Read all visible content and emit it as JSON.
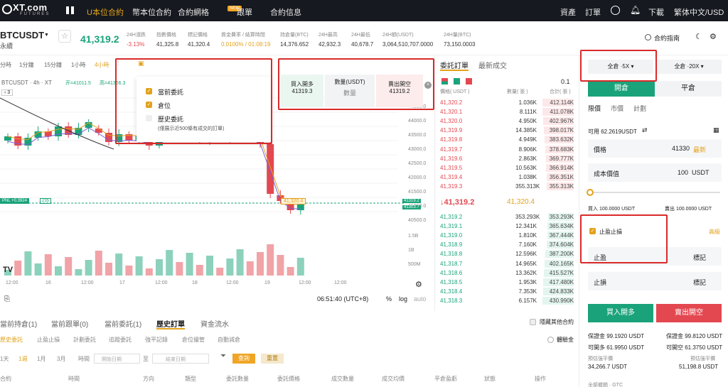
{
  "nav": {
    "logo": "XT.com",
    "logo_sub": "FUTURES",
    "items": [
      "U本位合約",
      "幣本位合約",
      "合約網格",
      "跟單",
      "合約信息"
    ],
    "new_badge": "NEW",
    "right": [
      "資產",
      "訂單",
      "下載",
      "繁体中文/USD"
    ]
  },
  "ticker": {
    "symbol": "BTCUSDT",
    "sub": "永續",
    "price": "41,319.2",
    "stats": [
      {
        "l": "24H漲跌",
        "v": "-3.13%"
      },
      {
        "l": "指數價格",
        "v": "41,325.8"
      },
      {
        "l": "標記價格",
        "v": "41,320.4"
      },
      {
        "l": "資金費率 / 結算時間",
        "v": "0.0100% / 01:08:19"
      },
      {
        "l": "持倉量(BTC)",
        "v": "14,376.652"
      },
      {
        "l": "24H最高",
        "v": "42,932.3"
      },
      {
        "l": "24H最低",
        "v": "40,678.7"
      },
      {
        "l": "24H額(USDT)",
        "v": "3,064,510,707.0000"
      },
      {
        "l": "24H量(BTC)",
        "v": "73,150.0003"
      }
    ],
    "guide": "合約指南"
  },
  "chart": {
    "timeframes": [
      "分時",
      "1分鐘",
      "15分鐘",
      "1小時",
      "4小時"
    ],
    "symbol_line": "BTCUSDT · 4h · XT",
    "open": "开=41011.5",
    "high": "高=41366.3",
    "price_ticks": [
      "44500.0",
      "44000.0",
      "43500.0",
      "43000.0",
      "42500.0",
      "42000.0",
      "41500.0",
      "41000.0",
      "40500.0"
    ],
    "vol_ticks": [
      "1.5B",
      "1B",
      "500M"
    ],
    "dates": [
      "12:00",
      "16",
      "12:00",
      "17",
      "12:00",
      "18",
      "12:00",
      "19",
      "12:00",
      "12:00"
    ],
    "pnl": "PNL +0.3924",
    "pnl_qty": "235",
    "mark": "41,320.4",
    "right_tags": [
      "41319.2",
      "41303.7"
    ],
    "time": "06:51:40 (UTC+8)",
    "bottom_controls": [
      "%",
      "log",
      "auto"
    ],
    "zoom": "3"
  },
  "popup": {
    "items": [
      "當前委託",
      "倉位",
      "歷史委託"
    ],
    "note": "(僅展示近500條有成交的訂單)"
  },
  "quick": {
    "buy_label": "買入開多",
    "buy_price": "41319.3",
    "qty_label": "數量(USDT)",
    "qty_val": "數量",
    "sell_label": "賣出開空",
    "sell_price": "41319.2"
  },
  "orderbook": {
    "tabs": [
      "委託訂單",
      "最新成交"
    ],
    "step": "0.1",
    "headers": [
      "價格( USDT )",
      "數量( 張 )",
      "合計( 張 )"
    ],
    "asks": [
      [
        "41,320.2",
        "1.036K",
        "412.114K"
      ],
      [
        "41,320.1",
        "8.111K",
        "411.078K"
      ],
      [
        "41,320.0",
        "4.950K",
        "402.967K"
      ],
      [
        "41,319.9",
        "14.385K",
        "398.017K"
      ],
      [
        "41,319.8",
        "4.949K",
        "383.632K"
      ],
      [
        "41,319.7",
        "8.906K",
        "378.683K"
      ],
      [
        "41,319.6",
        "2.863K",
        "369.777K"
      ],
      [
        "41,319.5",
        "10.563K",
        "366.914K"
      ],
      [
        "41,319.4",
        "1.038K",
        "356.351K"
      ],
      [
        "41,319.3",
        "355.313K",
        "355.313K"
      ]
    ],
    "last": "↓41,319.2",
    "mark": "41,320.4",
    "bids": [
      [
        "41,319.2",
        "353.293K",
        "353.293K"
      ],
      [
        "41,319.1",
        "12.341K",
        "365.634K"
      ],
      [
        "41,319.0",
        "1.810K",
        "367.444K"
      ],
      [
        "41,318.9",
        "7.160K",
        "374.604K"
      ],
      [
        "41,318.8",
        "12.596K",
        "387.200K"
      ],
      [
        "41,318.7",
        "14.965K",
        "402.165K"
      ],
      [
        "41,318.6",
        "13.362K",
        "415.527K"
      ],
      [
        "41,318.5",
        "1.953K",
        "417.480K"
      ],
      [
        "41,318.4",
        "7.353K",
        "424.833K"
      ],
      [
        "41,318.3",
        "6.157K",
        "430.990K"
      ]
    ]
  },
  "trade": {
    "lev_left": "全倉 ·5X",
    "lev_right": "全倉 ·20X",
    "tabs": [
      "開倉",
      "平倉"
    ],
    "types": [
      "限價",
      "市價",
      "計劃"
    ],
    "avail": "可用 62.2619USDT",
    "price_label": "價格",
    "price_val": "41330",
    "latest": "最新",
    "cost_label": "成本價值",
    "cost_val": "100",
    "cost_unit": "USDT",
    "buy_amt": "買入 100.0000 USDT",
    "sell_amt": "賣出 100.0000 USDT",
    "tpsl": "止盈止損",
    "adv": "高級",
    "tp": "止盈",
    "sl": "止損",
    "mark": "標記",
    "btn_buy": "買入開多",
    "btn_sell": "賣出開空",
    "margin_b": "保證金 99.1920 USDT",
    "margin_s": "保證金 99.8120 USDT",
    "open_b": "可開多 61.9950 USDT",
    "open_s": "可開空 61.3750 USDT",
    "liq_label": "預估強平價",
    "liq_b": "34,266.7 USDT",
    "liq_s": "51,198.8 USDT",
    "bottom": "全部撤銷 · GTC"
  },
  "bottom": {
    "tabs": [
      "當前持倉(1)",
      "當前跟單(0)",
      "當前委託(1)",
      "歷史訂單",
      "資金流水"
    ],
    "hide": "隱藏其他合約",
    "exp": "體驗金",
    "subtabs": [
      "歷史委託",
      "止盈止損",
      "計劃委託",
      "追蹤委託",
      "強平記錄",
      "倉位撮管",
      "自動減倉"
    ],
    "range": [
      "1天",
      "1週",
      "1月",
      "3月"
    ],
    "time": "時間",
    "start": "開始日期",
    "to": "至",
    "end": "結束日期",
    "query": "查詢",
    "reset": "重置",
    "cols": [
      "合約",
      "時間",
      "方向",
      "類型",
      "委託數量",
      "委託價格",
      "成交數量",
      "成交均價",
      "平倉盈虧",
      "狀態",
      "操作"
    ]
  },
  "colors": {
    "up": "#1aa37a",
    "down": "#e34850",
    "accent": "#e2a21b",
    "redbox": "#d92a2a"
  }
}
